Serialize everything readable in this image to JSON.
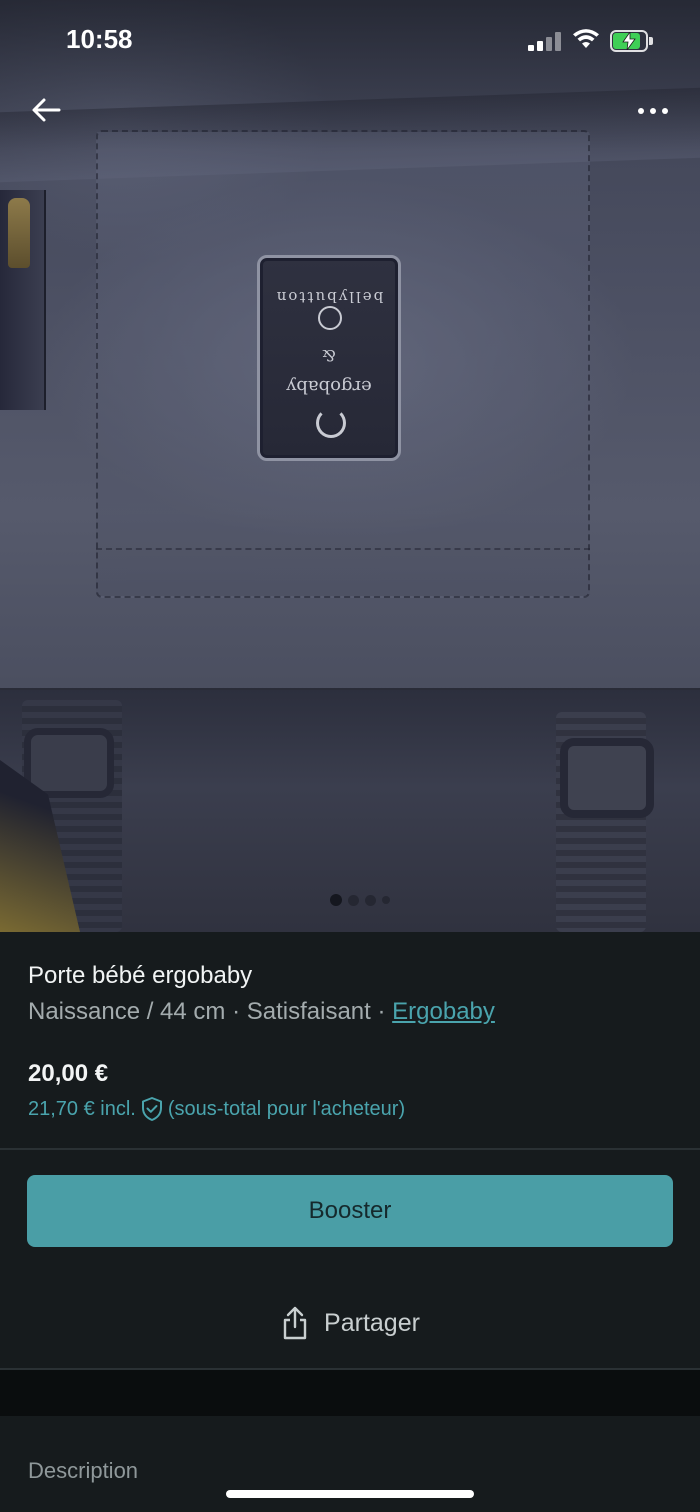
{
  "status_bar": {
    "time": "10:58",
    "battery_level": 0.85,
    "battery_color": "#3fcf56"
  },
  "nav": {
    "back_icon": "arrow-left-icon",
    "more_icon": "more-horizontal-icon"
  },
  "gallery": {
    "photo_count": 4,
    "active_index": 0,
    "label_text": {
      "line1": "bellybutton",
      "line2": "&",
      "line3": "ergobaby"
    }
  },
  "product": {
    "title": "Porte bébé ergobaby",
    "size": "Naissance / 44 cm",
    "separator1": " · ",
    "condition": "Satisfaisant",
    "separator2": " · ",
    "brand": "Ergobaby",
    "price": "20,00 €",
    "price_incl": "21,70 € incl.",
    "price_incl_note": "(sous-total pour l'acheteur)",
    "shield_icon": "shield-check-icon"
  },
  "actions": {
    "booster_label": "Booster",
    "share_label": "Partager",
    "share_icon": "share-icon"
  },
  "description": {
    "heading": "Description"
  },
  "colors": {
    "accent": "#4a9ea6",
    "link": "#4aa4ad",
    "background": "#161b1d"
  }
}
